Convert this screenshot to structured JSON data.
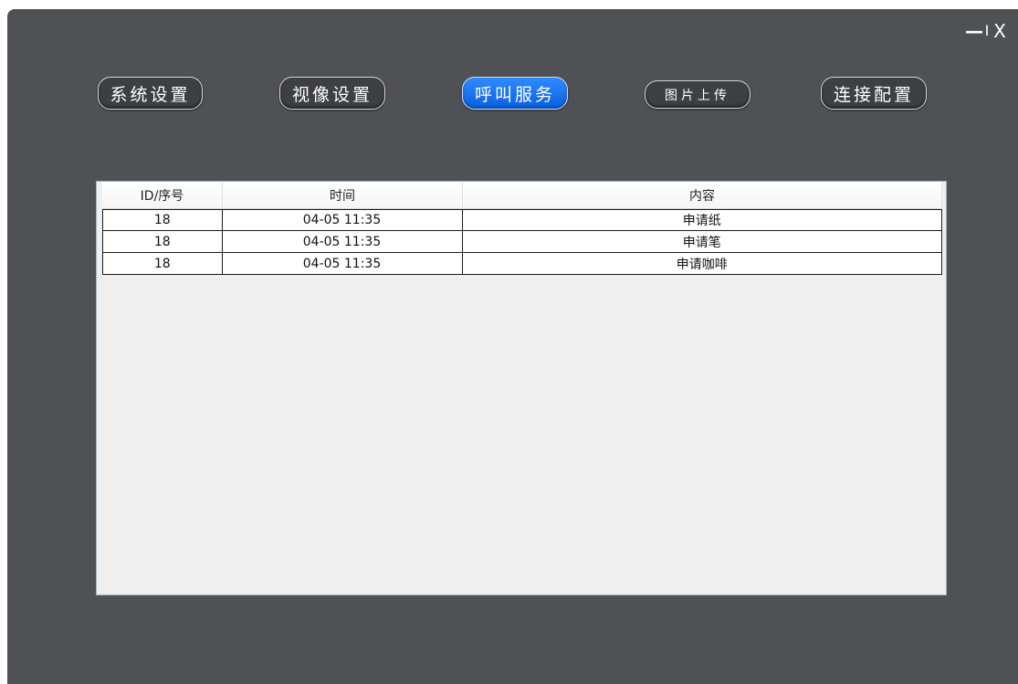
{
  "window": {
    "controls": {
      "minimize": "—",
      "separator": "I",
      "close": "X"
    }
  },
  "tabs": [
    {
      "label": "系统设置",
      "active": false
    },
    {
      "label": "视像设置",
      "active": false
    },
    {
      "label": "呼叫服务",
      "active": true
    },
    {
      "label": "图片上传",
      "active": false
    },
    {
      "label": "连接配置",
      "active": false
    }
  ],
  "accent_color": "#1a73f0",
  "table": {
    "headers": [
      "ID/序号",
      "时间",
      "内容"
    ],
    "rows": [
      [
        "18",
        "04-05 11:35",
        "申请纸"
      ],
      [
        "18",
        "04-05 11:35",
        "申请笔"
      ],
      [
        "18",
        "04-05 11:35",
        "申请咖啡"
      ]
    ]
  }
}
